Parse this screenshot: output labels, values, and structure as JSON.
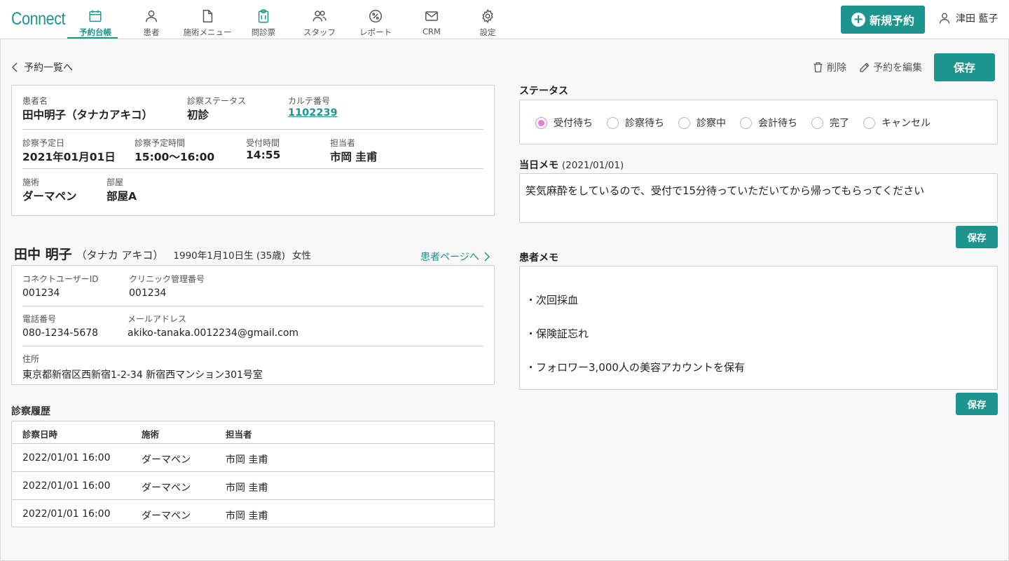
{
  "header": {
    "logo": "Connect",
    "nav": [
      {
        "label": "予約台帳",
        "icon": "calendar-icon",
        "active": true
      },
      {
        "label": "患者",
        "icon": "person-icon",
        "active": false
      },
      {
        "label": "施術メニュー",
        "icon": "document-icon",
        "active": false
      },
      {
        "label": "問診票",
        "icon": "clipboard-icon",
        "active": false
      },
      {
        "label": "スタッフ",
        "icon": "people-icon",
        "active": false
      },
      {
        "label": "レポート",
        "icon": "percent-icon",
        "active": false
      },
      {
        "label": "CRM",
        "icon": "mail-icon",
        "active": false
      },
      {
        "label": "設定",
        "icon": "gear-icon",
        "active": false
      }
    ],
    "new_reservation": "新規予約",
    "user_name": "津田 藍子"
  },
  "back_link": "予約一覧へ",
  "toolbar": {
    "delete": "削除",
    "edit": "予約を編集",
    "save": "保存"
  },
  "reservation": {
    "patient_name_label": "患者名",
    "patient_name": "田中明子（タナカアキコ）",
    "exam_status_label": "診察ステータス",
    "exam_status": "初診",
    "chart_no_label": "カルテ番号",
    "chart_no": "1102239",
    "date_label": "診察予定日",
    "date": "2021年01月01日",
    "time_label": "診察予定時間",
    "time": "15:00〜16:00",
    "reception_label": "受付時間",
    "reception": "14:55",
    "staff_label": "担当者",
    "staff": "市岡 圭甫",
    "treatment_label": "施術",
    "treatment": "ダーマペン",
    "room_label": "部屋",
    "room": "部屋A"
  },
  "patient": {
    "name": "田中 明子",
    "kana": "（タナカ アキコ）",
    "birth": "1990年1月10日生 (35歳)",
    "gender": "女性",
    "page_link": "患者ページへ",
    "user_id_label": "コネクトユーザーID",
    "user_id": "001234",
    "clinic_no_label": "クリニック管理番号",
    "clinic_no": "001234",
    "phone_label": "電話番号",
    "phone": "080-1234-5678",
    "email_label": "メールアドレス",
    "email": "akiko-tanaka.0012234@gmail.com",
    "address_label": "住所",
    "address": "東京都新宿区西新宿1-2-34 新宿西マンション301号室"
  },
  "history": {
    "title": "診察履歴",
    "columns": [
      "診察日時",
      "施術",
      "担当者"
    ],
    "rows": [
      [
        "2022/01/01 16:00",
        "ダーマペン",
        "市岡 圭甫"
      ],
      [
        "2022/01/01 16:00",
        "ダーマペン",
        "市岡 圭甫"
      ],
      [
        "2022/01/01 16:00",
        "ダーマペン",
        "市岡 圭甫"
      ]
    ]
  },
  "status": {
    "title": "ステータス",
    "options": [
      "受付待ち",
      "診察待ち",
      "診察中",
      "会計待ち",
      "完了",
      "キャンセル"
    ],
    "selected": "受付待ち"
  },
  "day_memo": {
    "title": "当日メモ",
    "date": "(2021/01/01)",
    "text": "笑気麻酔をしているので、受付で15分待っていただいてから帰ってもらってください",
    "save": "保存"
  },
  "patient_memo": {
    "title": "患者メモ",
    "lines": [
      "・次回採血",
      "・保険証忘れ",
      "・フォロワー3,000人の美容アカウントを保有"
    ],
    "save": "保存"
  },
  "colors": {
    "accent": "#1b958e",
    "radio_selected": "#e27fd0"
  }
}
